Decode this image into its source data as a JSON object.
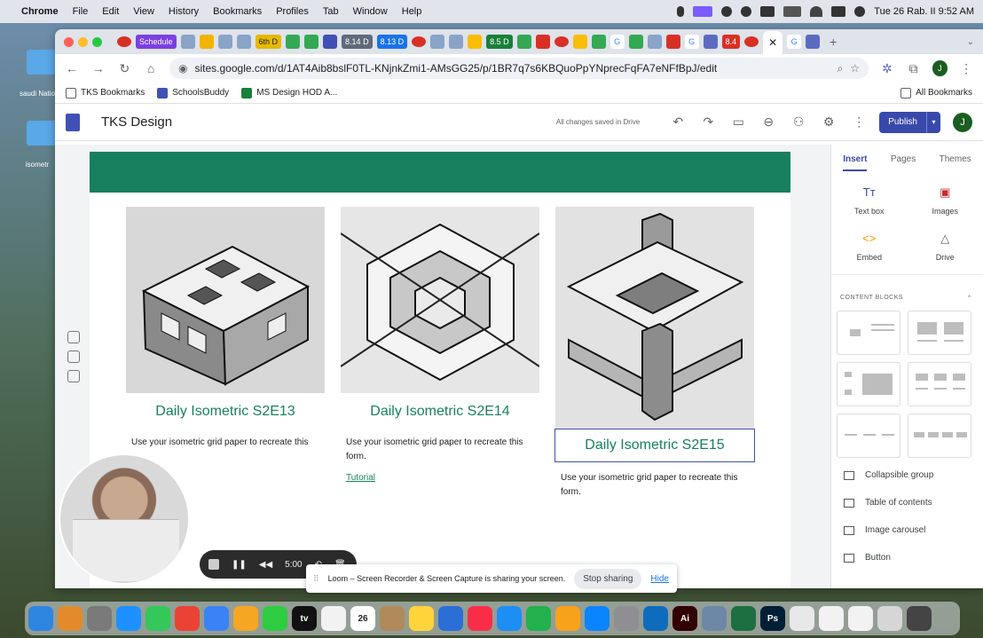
{
  "menubar": {
    "app": "Chrome",
    "items": [
      "File",
      "Edit",
      "View",
      "History",
      "Bookmarks",
      "Profiles",
      "Tab",
      "Window",
      "Help"
    ],
    "clock": "Tue 26 Rab. II  9:52 AM"
  },
  "desktop": {
    "items": [
      {
        "label": "saudi Natio",
        "color": "#5aa8e8"
      },
      {
        "label": "isometr",
        "color": "#5aa8e8"
      }
    ]
  },
  "tabs": {
    "chips": [
      {
        "label": "Schedule",
        "color": "#7b3fe4"
      },
      {
        "label": "6th D",
        "color": "#e6b800"
      },
      {
        "label": "8.14 D",
        "color": "#5f6b7a"
      },
      {
        "label": "8.13 D",
        "color": "#1a73e8"
      },
      {
        "label": "8.5 D",
        "color": "#188038"
      },
      {
        "label": "8.4",
        "color": "#d93025"
      }
    ]
  },
  "address": {
    "url": "sites.google.com/d/1AT4Aib8bslF0TL-KNjnkZmi1-AMsGG25/p/1BR7q7s6KBQuoPpYNprecFqFA7eNFfBpJ/edit",
    "profile_initial": "J"
  },
  "bookmarks": {
    "items": [
      {
        "label": "TKS Bookmarks",
        "icon": "folder-icon",
        "color": "#5f6368"
      },
      {
        "label": "SchoolsBuddy",
        "icon": "schoolsbuddy-icon",
        "color": "#3f51b5"
      },
      {
        "label": "MS Design HOD A...",
        "icon": "sheets-icon",
        "color": "#188038"
      }
    ],
    "all_label": "All Bookmarks"
  },
  "sites_header": {
    "title": "TKS Design",
    "status": "All changes saved in Drive",
    "publish": "Publish",
    "avatar": "J"
  },
  "page": {
    "banner_color": "#16805f",
    "cards": [
      {
        "title": "Daily Isometric S2E13",
        "desc": "Use your isometric grid paper to recreate this",
        "link": ""
      },
      {
        "title": "Daily Isometric S2E14",
        "desc": "Use your isometric grid paper to recreate this form.",
        "link": "Tutorial"
      },
      {
        "title": "Daily Isometric S2E15",
        "desc": "Use your isometric grid paper to recreate this form.",
        "link": ""
      }
    ]
  },
  "right_panel": {
    "tabs": [
      "Insert",
      "Pages",
      "Themes"
    ],
    "insert_items": [
      {
        "label": "Text box",
        "icon": "text-box-icon",
        "glyph": "Tт"
      },
      {
        "label": "Images",
        "icon": "images-icon",
        "glyph": "▣"
      },
      {
        "label": "Embed",
        "icon": "embed-icon",
        "glyph": "<>"
      },
      {
        "label": "Drive",
        "icon": "drive-icon",
        "glyph": "△"
      }
    ],
    "content_blocks_label": "CONTENT BLOCKS",
    "panel_list": [
      {
        "label": "Collapsible group",
        "icon": "collapsible-group-icon"
      },
      {
        "label": "Table of contents",
        "icon": "table-of-contents-icon"
      },
      {
        "label": "Image carousel",
        "icon": "image-carousel-icon"
      },
      {
        "label": "Button",
        "icon": "button-icon"
      }
    ]
  },
  "recorder": {
    "time": "5:00"
  },
  "share_bar": {
    "message": "Loom – Screen Recorder & Screen Capture is sharing your screen.",
    "stop": "Stop sharing",
    "hide": "Hide"
  },
  "dock": {
    "calendar_day": "26",
    "apps": [
      {
        "icon": "finder-icon",
        "color": "#2f86e0",
        "glyph": ""
      },
      {
        "icon": "launchpad-icon",
        "color": "#e38b2c",
        "glyph": ""
      },
      {
        "icon": "apps-grid-icon",
        "color": "#7a7a7a",
        "glyph": ""
      },
      {
        "icon": "safari-icon",
        "color": "#1e90ff",
        "glyph": ""
      },
      {
        "icon": "messages-icon",
        "color": "#34c759",
        "glyph": ""
      },
      {
        "icon": "chrome-icon",
        "color": "#ea4335",
        "glyph": ""
      },
      {
        "icon": "mail-icon",
        "color": "#3b82f6",
        "glyph": ""
      },
      {
        "icon": "photos-icon",
        "color": "#f5a623",
        "glyph": ""
      },
      {
        "icon": "facetime-icon",
        "color": "#2ecc40",
        "glyph": ""
      },
      {
        "icon": "apple-tv-icon",
        "color": "#111111",
        "glyph": "tv"
      },
      {
        "icon": "reminders-icon",
        "color": "#f2f2f2",
        "glyph": ""
      },
      {
        "icon": "calendar-icon",
        "color": "#ffffff",
        "glyph": ""
      },
      {
        "icon": "contacts-icon",
        "color": "#b08a5a",
        "glyph": ""
      },
      {
        "icon": "notes-icon",
        "color": "#ffd43b",
        "glyph": ""
      },
      {
        "icon": "freeform-icon",
        "color": "#2b6fd6",
        "glyph": ""
      },
      {
        "icon": "music-icon",
        "color": "#fa2d48",
        "glyph": ""
      },
      {
        "icon": "keynote-icon",
        "color": "#1d8ef2",
        "glyph": ""
      },
      {
        "icon": "numbers-icon",
        "color": "#22b14c",
        "glyph": ""
      },
      {
        "icon": "pages-icon",
        "color": "#f7a21b",
        "glyph": ""
      },
      {
        "icon": "app-store-icon",
        "color": "#0a84ff",
        "glyph": ""
      },
      {
        "icon": "system-settings-icon",
        "color": "#8e8e93",
        "glyph": ""
      },
      {
        "icon": "outlook-icon",
        "color": "#0f6cbd",
        "glyph": ""
      },
      {
        "icon": "illustrator-icon",
        "color": "#330000",
        "glyph": "Ai"
      },
      {
        "icon": "preview-icon",
        "color": "#6c88a6",
        "glyph": ""
      },
      {
        "icon": "excel-icon",
        "color": "#1d6f42",
        "glyph": ""
      },
      {
        "icon": "photoshop-icon",
        "color": "#001e36",
        "glyph": "Ps"
      },
      {
        "icon": "window-thumb-icon",
        "color": "#e8e8e8",
        "glyph": ""
      },
      {
        "icon": "window-thumb-icon",
        "color": "#f2f2f2",
        "glyph": ""
      },
      {
        "icon": "window-thumb-icon",
        "color": "#f2f2f2",
        "glyph": ""
      },
      {
        "icon": "trash-icon",
        "color": "#d6d6d6",
        "glyph": ""
      },
      {
        "icon": "screenshot-icon",
        "color": "#444444",
        "glyph": ""
      }
    ]
  }
}
